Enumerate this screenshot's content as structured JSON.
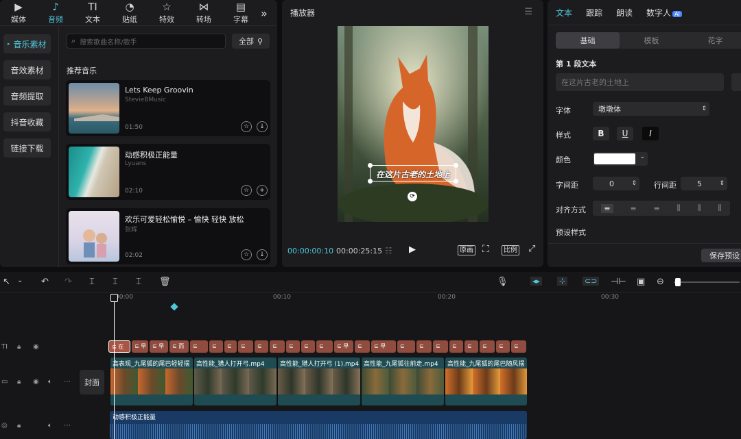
{
  "top_tabs": [
    {
      "label": "媒体",
      "icon": "media-icon"
    },
    {
      "label": "音频",
      "icon": "audio-icon",
      "active": true
    },
    {
      "label": "文本",
      "icon": "text-icon"
    },
    {
      "label": "贴纸",
      "icon": "sticker-icon"
    },
    {
      "label": "特效",
      "icon": "effects-icon"
    },
    {
      "label": "转场",
      "icon": "transition-icon"
    },
    {
      "label": "字幕",
      "icon": "subtitle-icon"
    }
  ],
  "side_nav": [
    "音乐素材",
    "音效素材",
    "音频提取",
    "抖音收藏",
    "链接下载"
  ],
  "search": {
    "placeholder": "搜索歌曲名称/歌手",
    "filter_label": "全部"
  },
  "recommended_title": "推荐音乐",
  "songs": [
    {
      "title": "Lets Keep Groovin",
      "artist": "StevieBMusic",
      "duration": "01:50"
    },
    {
      "title": "动感积极正能量",
      "artist": "Lyuans",
      "duration": "02:10"
    },
    {
      "title": "欢乐可爱轻松愉悦 – 愉快 轻快 放松",
      "artist": "张辉",
      "duration": "02:02"
    }
  ],
  "player": {
    "title": "播放器",
    "caption": "在这片古老的土地上",
    "current_time": "00:00:00:10",
    "total_time": "00:00:25:15",
    "btn_original": "原画",
    "btn_ratio": "比例"
  },
  "right_panel": {
    "tabs": [
      "文本",
      "跟踪",
      "朗读",
      "数字人"
    ],
    "ai_badge": "AI",
    "segments": [
      "基础",
      "模板",
      "花字"
    ],
    "section": "第 1 段文本",
    "text_placeholder": "在这片古老的土地上",
    "font_label": "字体",
    "font_value": "墩墩体",
    "style_label": "样式",
    "color_label": "颜色",
    "letter_spacing_label": "字间距",
    "letter_spacing": "0",
    "line_spacing_label": "行间距",
    "line_spacing": "5",
    "align_label": "对齐方式",
    "preset_label": "预设样式",
    "save_preset": "保存预设",
    "colors": {
      "text_color": "#ffffff",
      "accent": "#4fc6d8"
    }
  },
  "timeline": {
    "ruler": [
      "00:00",
      "00:10",
      "00:20",
      "00:30"
    ],
    "cover_label": "封面",
    "video_clips": [
      "高表现_九尾狐的尾巴轻轻摆",
      "高性能_猎人打开弓.mp4",
      "高性能_猎人打开弓 (1).mp4",
      "高性能_九尾狐往前走.mp4",
      "高性能_九尾狐的尾巴随风摆"
    ],
    "audio_clip": "动感积极正能量",
    "text_clips": [
      "在",
      "早",
      "早",
      "而",
      "早",
      "早"
    ]
  }
}
